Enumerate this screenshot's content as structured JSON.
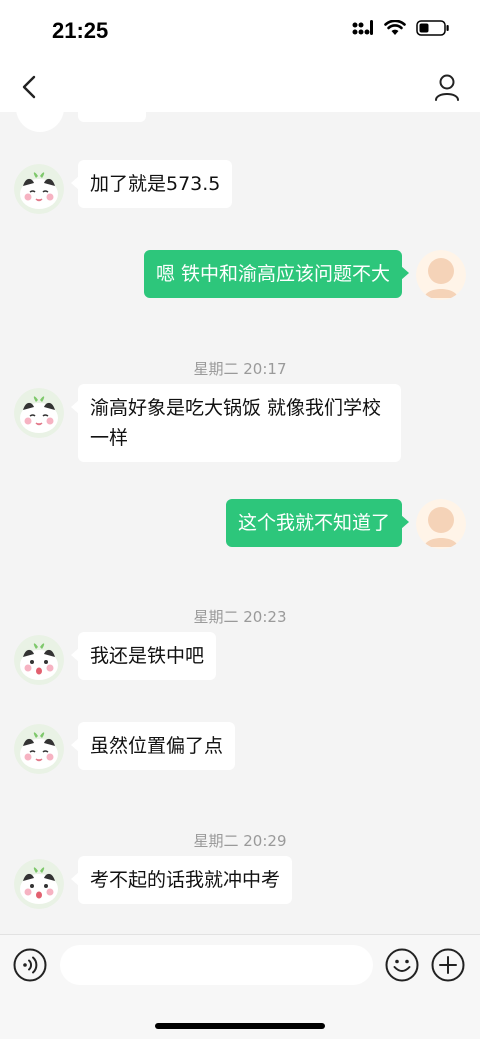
{
  "status_bar": {
    "time": "21:25"
  },
  "nav": {
    "title": ""
  },
  "colors": {
    "accent_green": "#2dc67b",
    "bubble_white": "#ffffff",
    "chat_bg": "#f4f4f4"
  },
  "messages": [
    {
      "side": "left",
      "text": "加了就是573.5"
    },
    {
      "side": "right",
      "text": "嗯  铁中和渝高应该问题不大"
    },
    {
      "timestamp": "星期二 20:17"
    },
    {
      "side": "left",
      "text": "渝高好象是吃大锅饭 就像我们学校一样"
    },
    {
      "side": "right",
      "text": "这个我就不知道了"
    },
    {
      "timestamp": "星期二 20:23"
    },
    {
      "side": "left",
      "text": "我还是铁中吧"
    },
    {
      "side": "left",
      "text": "虽然位置偏了点"
    },
    {
      "timestamp": "星期二 20:29"
    },
    {
      "side": "left",
      "text": "考不起的话我就冲中考"
    }
  ],
  "input": {
    "placeholder": "",
    "value": ""
  },
  "icons": [
    "back-arrow-icon",
    "profile-icon",
    "voice-icon",
    "emoji-icon",
    "plus-icon",
    "signal-icon",
    "wifi-icon",
    "battery-icon"
  ]
}
